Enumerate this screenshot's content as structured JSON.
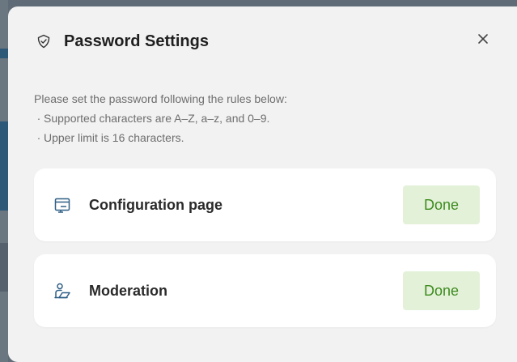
{
  "dialog": {
    "title": "Password Settings",
    "title_icon": "shield-check-icon",
    "close_icon": "close-icon"
  },
  "description": {
    "intro": "Please set the password following the rules below:",
    "bullet": "·",
    "rules": [
      "Supported characters are A–Z, a–z, and 0–9.",
      "Upper limit is 16 characters."
    ]
  },
  "items": [
    {
      "icon": "configuration-page-icon",
      "label": "Configuration page",
      "status": "Done"
    },
    {
      "icon": "moderation-icon",
      "label": "Moderation",
      "status": "Done"
    }
  ],
  "colors": {
    "accent_green": "#3e8b1f",
    "done_bg": "#e3f1d9",
    "icon_blue": "#2f5f86",
    "dialog_bg": "#f2f2f3"
  }
}
